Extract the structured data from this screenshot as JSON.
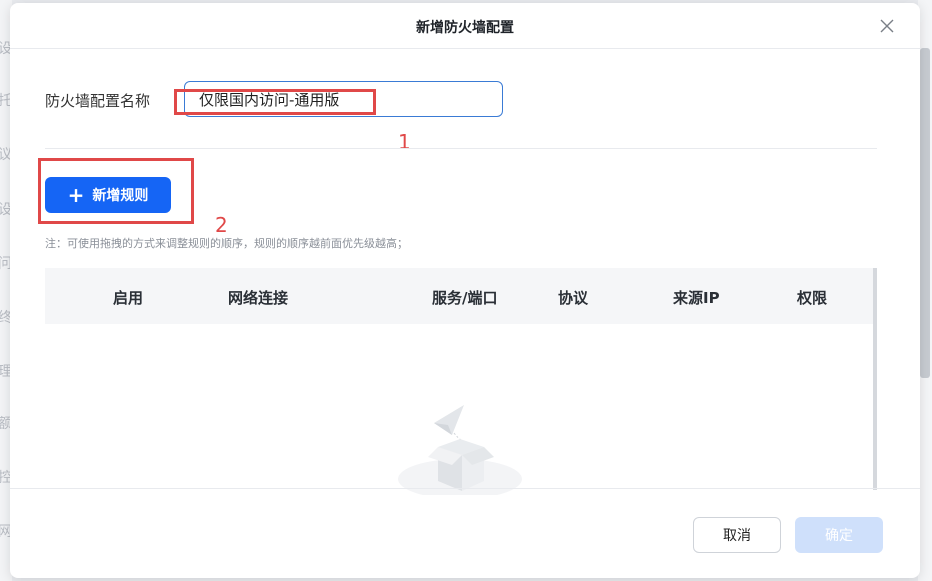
{
  "background": {
    "glyphs": [
      "设",
      "托",
      "议",
      "设",
      "问",
      "终",
      "理",
      "额",
      "控",
      "网"
    ]
  },
  "dialog": {
    "title": "新增防火墙配置",
    "close_icon": "close-icon"
  },
  "form": {
    "name_label": "防火墙配置名称",
    "name_value": "仅限国内访问-通用版"
  },
  "annotations": {
    "label_1": "1",
    "label_2": "2",
    "color": "#e04848"
  },
  "toolbar": {
    "add_rule_icon": "plus-icon",
    "add_rule_label": "新增规则"
  },
  "note": "注：可使用拖拽的方式来调整规则的顺序，规则的顺序越前面优先级越高；",
  "table": {
    "columns": [
      "启用",
      "网络连接",
      "服务/端口",
      "协议",
      "来源IP",
      "权限"
    ]
  },
  "footer": {
    "cancel_label": "取消",
    "confirm_label": "确定"
  },
  "colors": {
    "primary": "#1565f5",
    "primary_disabled": "#cfe0fb",
    "input_border": "#3a7bd5"
  }
}
